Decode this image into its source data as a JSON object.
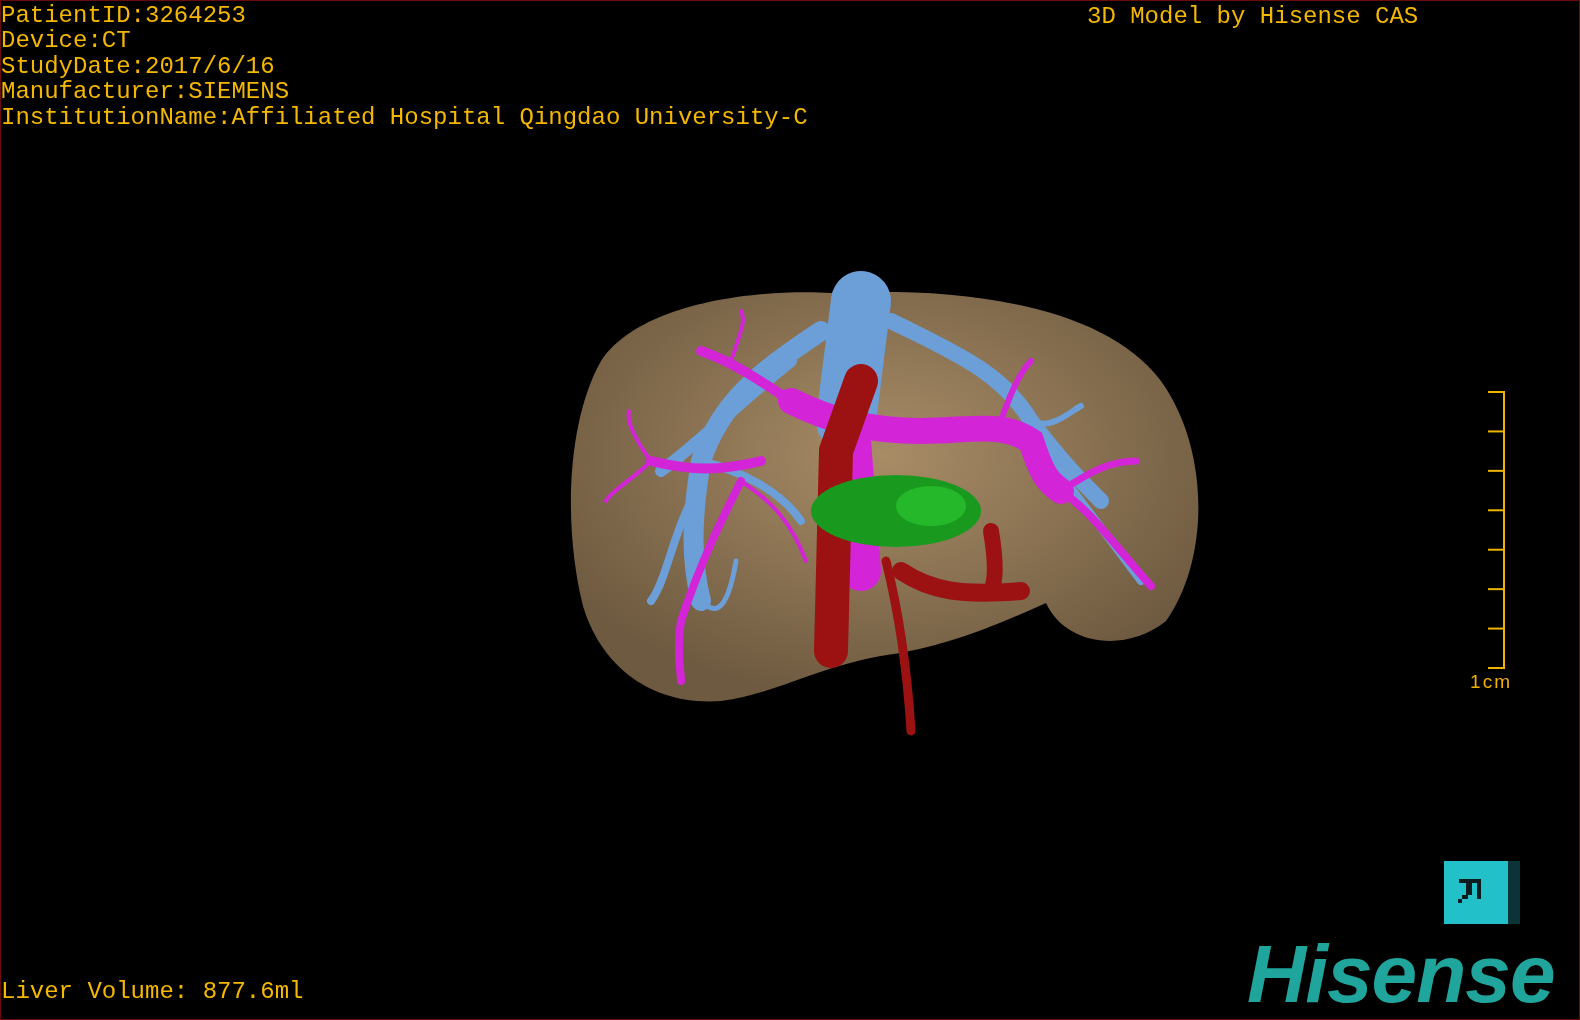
{
  "study_info": [
    "PatientID:3264253",
    "Device:CT",
    "StudyDate:2017/6/16",
    "Manufacturer:SIEMENS",
    "InstitutionName:Affiliated Hospital Qingdao University-C"
  ],
  "title": "3D Model by Hisense CAS",
  "scale_bar": {
    "label": "1cm"
  },
  "logo": "Hisense",
  "liver_volume": "Liver Volume: 877.6ml"
}
